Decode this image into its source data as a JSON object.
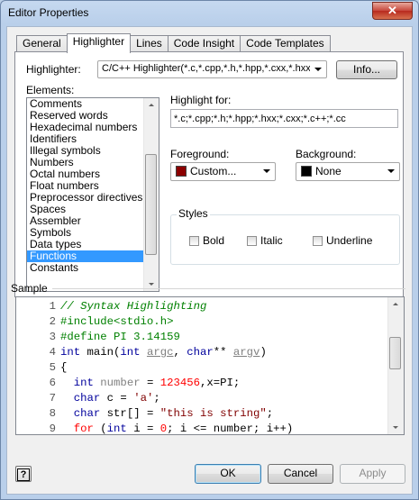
{
  "window": {
    "title": "Editor Properties",
    "close_glyph": "✕"
  },
  "tabs": [
    {
      "label": "General",
      "active": false
    },
    {
      "label": "Highlighter",
      "active": true
    },
    {
      "label": "Lines",
      "active": false
    },
    {
      "label": "Code Insight",
      "active": false
    },
    {
      "label": "Code Templates",
      "active": false
    }
  ],
  "highlighter": {
    "label": "Highlighter:",
    "value": "C/C++ Highlighter(*.c,*.cpp,*.h,*.hpp,*.cxx,*.hxx,*.",
    "info_button": "Info..."
  },
  "elements": {
    "label": "Elements:",
    "items": [
      "Comments",
      "Reserved words",
      "Hexadecimal numbers",
      "Identifiers",
      "Illegal symbols",
      "Numbers",
      "Octal numbers",
      "Float numbers",
      "Preprocessor directives",
      "Spaces",
      "Assembler",
      "Symbols",
      "Data types",
      "Functions",
      "Constants"
    ],
    "selected": "Functions"
  },
  "highlight_for": {
    "label": "Highlight for:",
    "value": "*.c;*.cpp;*.h;*.hpp;*.hxx;*.cxx;*.c++;*.cc"
  },
  "foreground": {
    "label": "Foreground:",
    "value": "Custom...",
    "color": "#8b0000"
  },
  "background": {
    "label": "Background:",
    "value": "None",
    "color": "#000000"
  },
  "styles": {
    "label": "Styles",
    "bold": {
      "label": "Bold",
      "checked": false
    },
    "italic": {
      "label": "Italic",
      "checked": false
    },
    "underline": {
      "label": "Underline",
      "checked": false
    }
  },
  "sample": {
    "label": "Sample",
    "lines": [
      {
        "n": "1",
        "tokens": [
          {
            "t": "// Syntax Highlighting",
            "c": "cmt"
          }
        ]
      },
      {
        "n": "2",
        "tokens": [
          {
            "t": "#include<stdio.h>",
            "c": "pp"
          }
        ]
      },
      {
        "n": "3",
        "tokens": [
          {
            "t": "#define PI 3.14159",
            "c": "pp"
          }
        ]
      },
      {
        "n": "4",
        "tokens": [
          {
            "t": "int",
            "c": "kw"
          },
          {
            "t": " main(",
            "c": ""
          },
          {
            "t": "int",
            "c": "kw"
          },
          {
            "t": " ",
            "c": ""
          },
          {
            "t": "argc",
            "c": "id ul"
          },
          {
            "t": ", ",
            "c": ""
          },
          {
            "t": "char",
            "c": "kw"
          },
          {
            "t": "** ",
            "c": ""
          },
          {
            "t": "argv",
            "c": "id ul"
          },
          {
            "t": ")",
            "c": ""
          }
        ]
      },
      {
        "n": "5",
        "tokens": [
          {
            "t": "{",
            "c": ""
          }
        ]
      },
      {
        "n": "6",
        "tokens": [
          {
            "t": "  ",
            "c": ""
          },
          {
            "t": "int",
            "c": "kw"
          },
          {
            "t": " ",
            "c": ""
          },
          {
            "t": "number",
            "c": "id"
          },
          {
            "t": " = ",
            "c": ""
          },
          {
            "t": "123456",
            "c": "num"
          },
          {
            "t": ",x=PI;",
            "c": ""
          }
        ]
      },
      {
        "n": "7",
        "tokens": [
          {
            "t": "  ",
            "c": ""
          },
          {
            "t": "char",
            "c": "kw"
          },
          {
            "t": " c = ",
            "c": ""
          },
          {
            "t": "'a'",
            "c": "str"
          },
          {
            "t": ";",
            "c": ""
          }
        ]
      },
      {
        "n": "8",
        "tokens": [
          {
            "t": "  ",
            "c": ""
          },
          {
            "t": "char",
            "c": "kw"
          },
          {
            "t": " str[] = ",
            "c": ""
          },
          {
            "t": "\"this is string\"",
            "c": "str"
          },
          {
            "t": ";",
            "c": ""
          }
        ]
      },
      {
        "n": "9",
        "tokens": [
          {
            "t": "  ",
            "c": ""
          },
          {
            "t": "for",
            "c": "num"
          },
          {
            "t": " (",
            "c": ""
          },
          {
            "t": "int",
            "c": "kw"
          },
          {
            "t": " i = ",
            "c": ""
          },
          {
            "t": "0",
            "c": "num"
          },
          {
            "t": "; i <= number; i++)",
            "c": ""
          }
        ]
      }
    ]
  },
  "buttons": {
    "help": "?",
    "ok": "OK",
    "cancel": "Cancel",
    "apply": "Apply"
  }
}
